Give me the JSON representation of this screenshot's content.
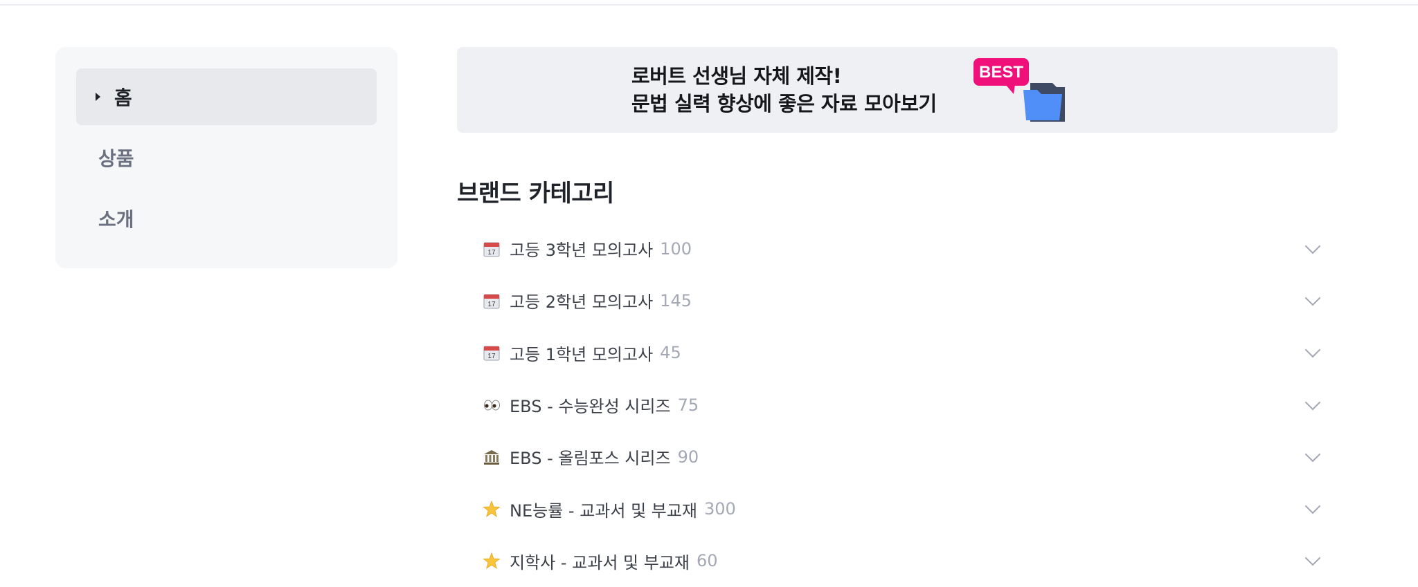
{
  "sidebar": {
    "items": [
      {
        "label": "홈",
        "active": true
      },
      {
        "label": "상품",
        "active": false
      },
      {
        "label": "소개",
        "active": false
      }
    ]
  },
  "banner": {
    "line1": "로버트 선생님 자체 제작!",
    "line2": "문법 실력 향상에 좋은 자료 모아보기",
    "badge": "BEST",
    "icon": "folder-icon"
  },
  "section": {
    "title": "브랜드 카테고리"
  },
  "categories": [
    {
      "icon": "calendar-icon",
      "label": "고등 3학년 모의고사",
      "count": "100"
    },
    {
      "icon": "calendar-icon",
      "label": "고등 2학년 모의고사",
      "count": "145"
    },
    {
      "icon": "calendar-icon",
      "label": "고등 1학년 모의고사",
      "count": "45"
    },
    {
      "icon": "eyes-icon",
      "label": "EBS - 수능완성 시리즈",
      "count": "75"
    },
    {
      "icon": "classical-building-icon",
      "label": "EBS - 올림포스 시리즈",
      "count": "90"
    },
    {
      "icon": "star-icon",
      "label": "NE능률 - 교과서 및 부교재",
      "count": "300"
    },
    {
      "icon": "star-icon",
      "label": "지학사 - 교과서 및 부교재",
      "count": "60"
    }
  ],
  "colors": {
    "accent_badge": "#f0107a",
    "folder_blue": "#4f8ff7"
  }
}
